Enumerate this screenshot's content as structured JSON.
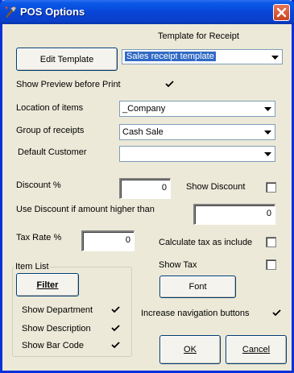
{
  "window": {
    "title": "POS Options"
  },
  "template": {
    "header": "Template for Receipt",
    "edit_label": "Edit Template",
    "selected": "Sales receipt template"
  },
  "preview": {
    "label": "Show Preview before Print",
    "checked": true
  },
  "location": {
    "label": "Location of items",
    "value": "_Company"
  },
  "group": {
    "label": "Group of receipts",
    "value": "Cash Sale"
  },
  "customer": {
    "label": "Default Customer",
    "value": ""
  },
  "discount": {
    "label": "Discount %",
    "value": "0",
    "show_label": "Show Discount",
    "show_checked": false,
    "threshold_label": "Use Discount if amount higher than",
    "threshold_value": "0"
  },
  "tax": {
    "label": "Tax Rate %",
    "value": "0",
    "include_label": "Calculate tax as include",
    "include_checked": false,
    "show_label": "Show Tax",
    "show_checked": false
  },
  "item_list": {
    "legend": "Item List",
    "filter_label": "Filter",
    "department_label": "Show Department",
    "department_checked": true,
    "description_label": "Show Description",
    "description_checked": true,
    "barcode_label": "Show Bar Code",
    "barcode_checked": true
  },
  "font_label": "Font",
  "nav": {
    "label": "Increase navigation buttons",
    "checked": true
  },
  "buttons": {
    "ok": "OK",
    "cancel": "Cancel"
  }
}
